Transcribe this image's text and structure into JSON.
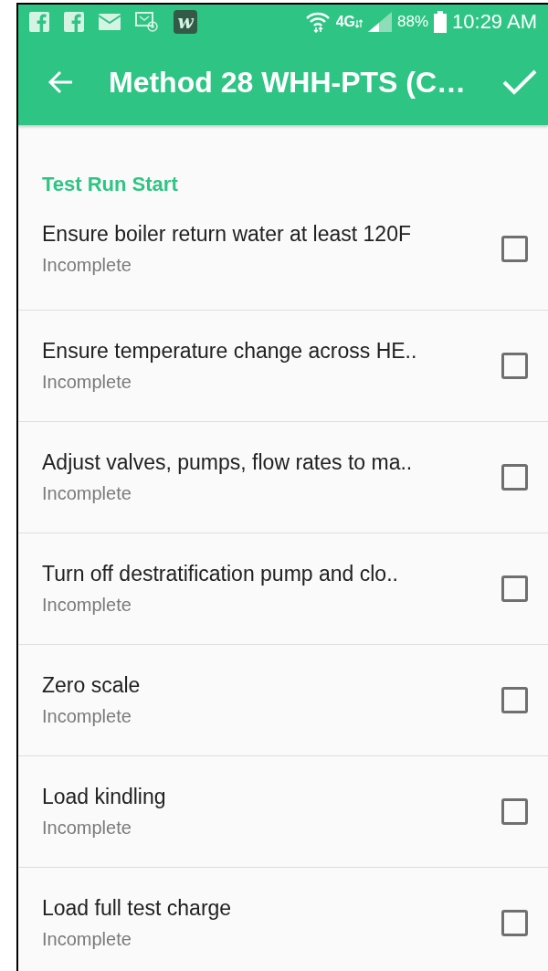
{
  "status_bar": {
    "app_icons": [
      {
        "kind": "facebook"
      },
      {
        "kind": "facebook"
      },
      {
        "kind": "mail"
      },
      {
        "kind": "message"
      },
      {
        "kind": "app",
        "label": "w"
      }
    ],
    "network": "4G",
    "battery": "88%",
    "time": "10:29 AM"
  },
  "app_bar": {
    "title": "Method 28 WHH-PTS (C…"
  },
  "section": {
    "title": "Test Run Start"
  },
  "items": [
    {
      "title": "Ensure boiler return water at least 120F",
      "status": "Incomplete",
      "checked": false
    },
    {
      "title": "Ensure temperature change across HE..",
      "status": "Incomplete",
      "checked": false
    },
    {
      "title": "Adjust valves, pumps, flow rates to ma..",
      "status": "Incomplete",
      "checked": false
    },
    {
      "title": "Turn off destratification pump and clo..",
      "status": "Incomplete",
      "checked": false
    },
    {
      "title": "Zero scale",
      "status": "Incomplete",
      "checked": false
    },
    {
      "title": "Load kindling",
      "status": "Incomplete",
      "checked": false
    },
    {
      "title": "Load full test charge",
      "status": "Incomplete",
      "checked": false
    }
  ]
}
